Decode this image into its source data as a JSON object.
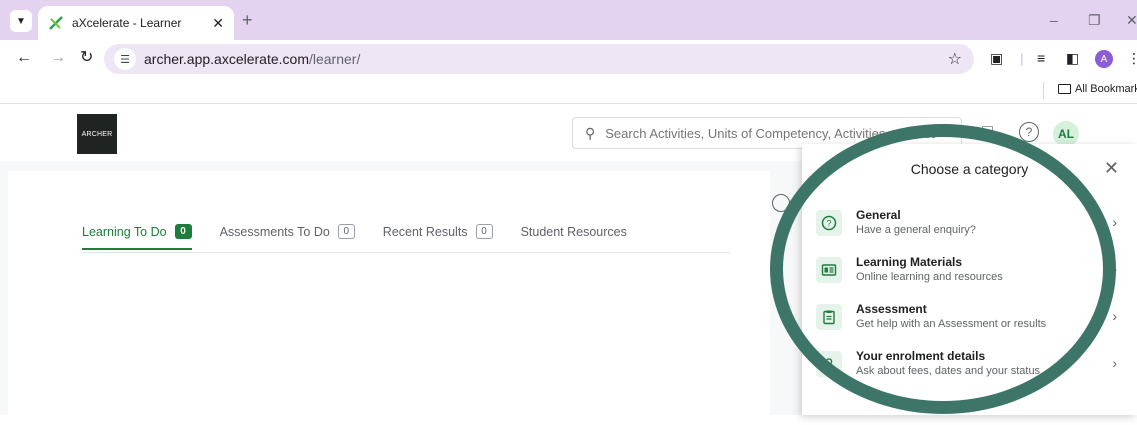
{
  "browser": {
    "tab_title": "aXcelerate - Learner",
    "url_host": "archer.app.axcelerate.com",
    "url_path": "/learner/",
    "profile_initial": "A",
    "bookmarks_label": "All Bookmarks"
  },
  "header": {
    "logo_text": "ARCHER",
    "search_placeholder": "Search Activities, Units of Competency, Activities and Reso...",
    "avatar_initials": "AL"
  },
  "learner_tabs": [
    {
      "label": "Learning To Do",
      "count": "0",
      "active": true
    },
    {
      "label": "Assessments To Do",
      "count": "0",
      "active": false
    },
    {
      "label": "Recent Results",
      "count": "0",
      "active": false
    },
    {
      "label": "Student Resources",
      "count": "",
      "active": false
    }
  ],
  "category_panel": {
    "title": "Choose a category",
    "items": [
      {
        "title": "General",
        "desc": "Have a general enquiry?",
        "icon": "question-circle-icon"
      },
      {
        "title": "Learning Materials",
        "desc": "Online learning and resources",
        "icon": "book-card-icon"
      },
      {
        "title": "Assessment",
        "desc": "Get help with an Assessment or results",
        "icon": "clipboard-icon"
      },
      {
        "title": "Your enrolment details",
        "desc": "Ask about fees, dates and your status",
        "icon": "person-icon"
      }
    ]
  },
  "colors": {
    "brand_green": "#1e7c3c",
    "annotation_ring": "#3d7668",
    "tabbar": "#e3d3f0"
  }
}
